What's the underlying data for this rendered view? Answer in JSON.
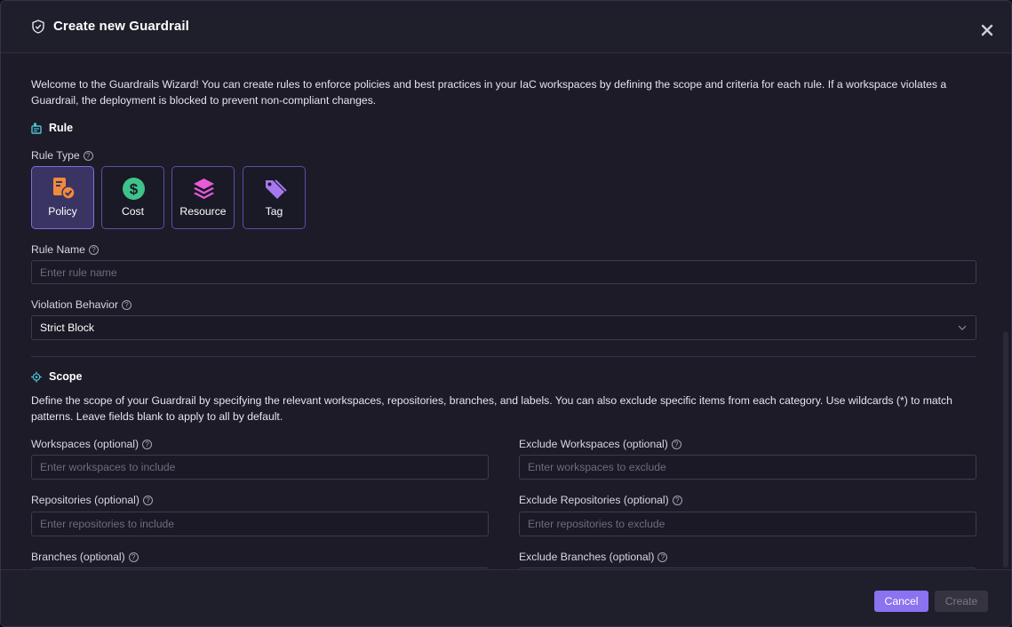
{
  "dialog": {
    "title": "Create new Guardrail",
    "title_icon": "shield-icon",
    "close_icon": "close-icon"
  },
  "intro": "Welcome to the Guardrails Wizard! You can create rules to enforce policies and best practices in your IaC workspaces by defining the scope and criteria for each rule. If a workspace violates a Guardrail, the deployment is blocked to prevent non-compliant changes.",
  "rule_section": {
    "title": "Rule",
    "icon": "rule-icon",
    "rule_type_label": "Rule Type",
    "rule_types": [
      {
        "label": "Policy",
        "icon": "policy-icon",
        "selected": true
      },
      {
        "label": "Cost",
        "icon": "dollar-icon",
        "selected": false
      },
      {
        "label": "Resource",
        "icon": "layers-icon",
        "selected": false
      },
      {
        "label": "Tag",
        "icon": "tag-icon",
        "selected": false
      }
    ],
    "rule_name_label": "Rule Name",
    "rule_name_placeholder": "Enter rule name",
    "violation_label": "Violation Behavior",
    "violation_value": "Strict Block"
  },
  "scope_section": {
    "title": "Scope",
    "icon": "target-icon",
    "description": "Define the scope of your Guardrail by specifying the relevant workspaces, repositories, branches, and labels. You can also exclude specific items from each category. Use wildcards (*) to match patterns. Leave fields blank to apply to all by default.",
    "workspaces_label": "Workspaces (optional)",
    "workspaces_placeholder": "Enter workspaces to include",
    "exclude_workspaces_label": "Exclude Workspaces (optional)",
    "exclude_workspaces_placeholder": "Enter workspaces to exclude",
    "repositories_label": "Repositories (optional)",
    "repositories_placeholder": "Enter repositories to include",
    "exclude_repositories_label": "Exclude Repositories (optional)",
    "exclude_repositories_placeholder": "Enter repositories to exclude",
    "branches_label": "Branches (optional)",
    "exclude_branches_label": "Exclude Branches (optional)"
  },
  "footer": {
    "cancel_label": "Cancel",
    "create_label": "Create"
  },
  "colors": {
    "accent": "#8b72f0",
    "background": "#1c1b27",
    "policy_icon": "#f08a3c",
    "cost_icon": "#3ec48a",
    "resource_icon": "#e85ad8",
    "tag_icon": "#a678f0"
  }
}
